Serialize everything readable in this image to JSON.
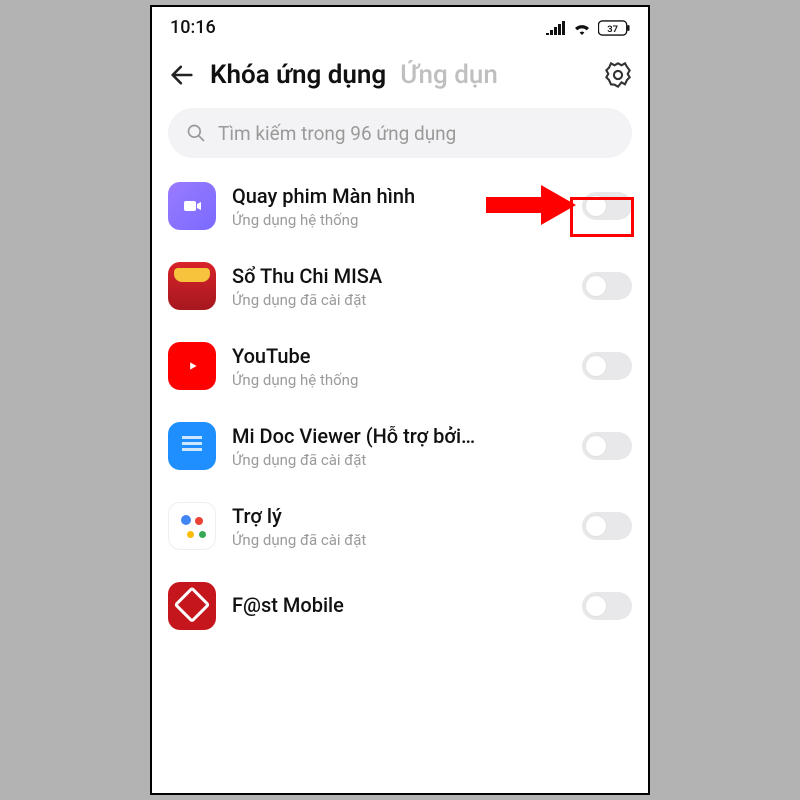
{
  "status": {
    "time": "10:16",
    "battery": "37"
  },
  "header": {
    "title": "Khóa ứng dụng",
    "tab_faded": "Ứng dụn"
  },
  "search": {
    "placeholder": "Tìm kiếm trong 96 ứng dụng"
  },
  "apps": [
    {
      "name": "Quay phim Màn hình",
      "sub": "Ứng dụng hệ thống",
      "icon": "screen-recorder"
    },
    {
      "name": "Sổ Thu Chi MISA",
      "sub": "Ứng dụng đã cài đặt",
      "icon": "misa"
    },
    {
      "name": "YouTube",
      "sub": "Ứng dụng hệ thống",
      "icon": "youtube"
    },
    {
      "name": "Mi Doc Viewer (Hỗ trợ bởi…",
      "sub": "Ứng dụng đã cài đặt",
      "icon": "midoc"
    },
    {
      "name": "Trợ lý",
      "sub": "Ứng dụng đã cài đặt",
      "icon": "assistant"
    },
    {
      "name": "F@st Mobile",
      "sub": "",
      "icon": "fast-mobile"
    }
  ],
  "annotation": {
    "highlight_index": 0
  }
}
